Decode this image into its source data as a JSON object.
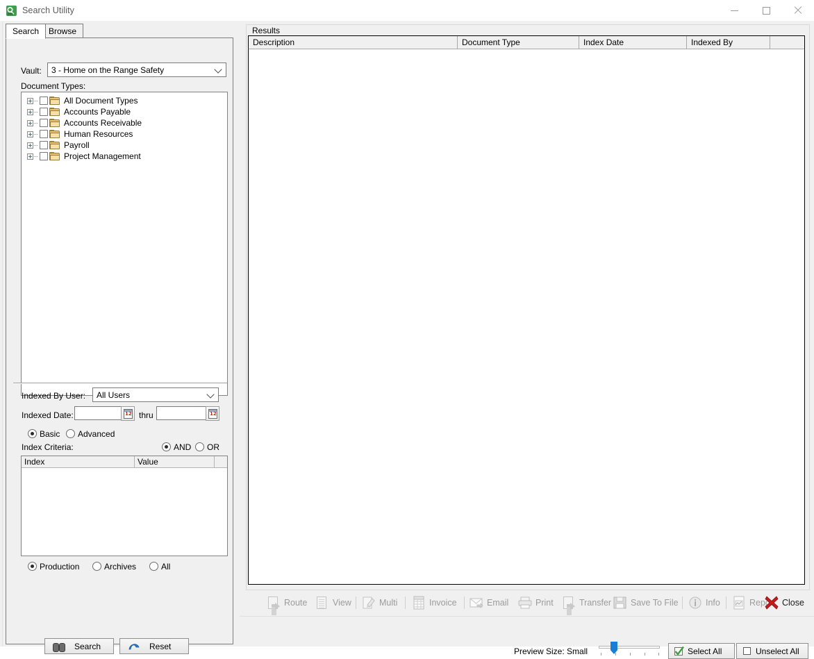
{
  "window": {
    "title": "Search Utility",
    "icon": "search-utility-icon",
    "controls": {
      "minimize": "—",
      "maximize": "□",
      "close": "✕"
    }
  },
  "tabs": [
    {
      "label": "Search",
      "active": true
    },
    {
      "label": "Browse",
      "active": false
    }
  ],
  "search_tab": {
    "vault": {
      "label": "Vault:",
      "value": "3 - Home on the Range Safety",
      "options": [
        "3 - Home on the Range Safety"
      ]
    },
    "document_types": {
      "label": "Document Types:",
      "nodes": [
        {
          "label": "All Document Types",
          "checked": false,
          "expanded": false
        },
        {
          "label": "Accounts Payable",
          "checked": false,
          "expanded": false
        },
        {
          "label": "Accounts Receivable",
          "checked": false,
          "expanded": false
        },
        {
          "label": "Human Resources",
          "checked": false,
          "expanded": false
        },
        {
          "label": "Payroll",
          "checked": false,
          "expanded": false
        },
        {
          "label": "Project Management",
          "checked": false,
          "expanded": false
        }
      ]
    },
    "indexed_by_user": {
      "label": "Indexed By User:",
      "value": "All Users",
      "options": [
        "All Users"
      ]
    },
    "indexed_date": {
      "label": "Indexed Date:",
      "from_value": "",
      "to_value": "",
      "thru_label": "thru",
      "calendar_icon": "calendar-icon"
    },
    "mode": {
      "basic_label": "Basic",
      "advanced_label": "Advanced",
      "selected": "Basic"
    },
    "index_criteria": {
      "label": "Index Criteria:",
      "and_label": "AND",
      "or_label": "OR",
      "operator": "AND",
      "columns": [
        "Index",
        "Value"
      ],
      "rows": []
    },
    "scope": {
      "production_label": "Production",
      "archives_label": "Archives",
      "all_label": "All",
      "selected": "Production"
    },
    "actions": {
      "search_label": "Search",
      "search_icon": "binoculars-icon",
      "reset_label": "Reset",
      "reset_icon": "reset-icon"
    }
  },
  "results": {
    "legend": "Results",
    "columns": [
      "Description",
      "Document Type",
      "Index Date",
      "Indexed By"
    ],
    "rows": []
  },
  "toolbar": {
    "buttons": [
      {
        "label": "Route",
        "icon": "route-icon",
        "enabled": false
      },
      {
        "label": "View",
        "icon": "view-icon",
        "enabled": false
      },
      {
        "label": "Multi",
        "icon": "multi-icon",
        "enabled": false
      },
      {
        "label": "Invoice",
        "icon": "invoice-icon",
        "enabled": false
      },
      {
        "label": "Email",
        "icon": "email-icon",
        "enabled": false
      },
      {
        "label": "Print",
        "icon": "print-icon",
        "enabled": false
      },
      {
        "label": "Transfer",
        "icon": "transfer-icon",
        "enabled": false
      },
      {
        "label": "Save To File",
        "icon": "save-to-file-icon",
        "enabled": false
      },
      {
        "label": "Info",
        "icon": "info-icon",
        "enabled": false
      },
      {
        "label": "Report",
        "icon": "report-icon",
        "enabled": false
      },
      {
        "label": "Close",
        "icon": "close-x-icon",
        "enabled": true
      }
    ]
  },
  "bottom_bar": {
    "preview_size_label": "Preview Size: Small",
    "preview_size_value": "Small",
    "select_all_label": "Select All",
    "select_all_icon": "green-check-icon",
    "unselect_all_label": "Unselect All",
    "unselect_all_icon": "empty-checkbox-icon"
  },
  "colors": {
    "accent_blue": "#1a7fd4",
    "green_check": "#3ba23b",
    "close_red": "#b81c1c",
    "window_bg": "#f0f0f0",
    "field_bg": "#ffffff"
  }
}
